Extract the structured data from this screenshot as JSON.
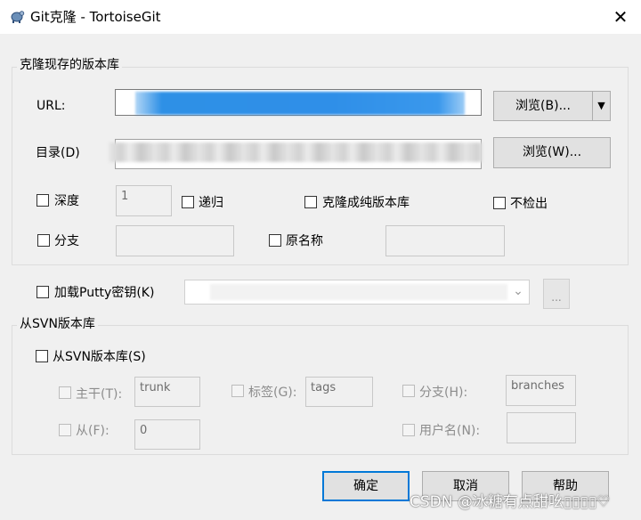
{
  "window": {
    "title": "Git克隆 - TortoiseGit",
    "close_glyph": "✕",
    "app_icon": "tortoise-icon"
  },
  "clone_group": {
    "legend": "克隆现存的版本库",
    "url_label": "URL:",
    "url_browse": "浏览(B)...",
    "url_dropdown_glyph": "▼",
    "dir_label": "目录(D)",
    "dir_browse": "浏览(W)...",
    "depth_label": "深度",
    "depth_value": "1",
    "recursive_label": "递归",
    "bare_label": "克隆成纯版本库",
    "no_checkout_label": "不检出",
    "branch_label": "分支",
    "origin_label": "原名称"
  },
  "putty": {
    "label": "加载Putty密钥(K)",
    "dropdown_glyph": "⌄",
    "browse": "..."
  },
  "svn_group": {
    "legend": "从SVN版本库",
    "from_svn_label": "从SVN版本库(S)",
    "trunk_label": "主干(T):",
    "trunk_value": "trunk",
    "tags_label": "标签(G):",
    "tags_value": "tags",
    "branch_label": "分支(H):",
    "branch_value": "branches",
    "from_label": "从(F):",
    "from_value": "0",
    "username_label": "用户名(N):"
  },
  "buttons": {
    "ok": "确定",
    "cancel": "取消",
    "help": "帮助"
  },
  "watermark": "CSDN @冰糖有点甜吆▯▯▯▯♡",
  "colors": {
    "accent": "#0078d7",
    "window_bg": "#f0f0f0",
    "url_blur": "#2f8fe8"
  }
}
